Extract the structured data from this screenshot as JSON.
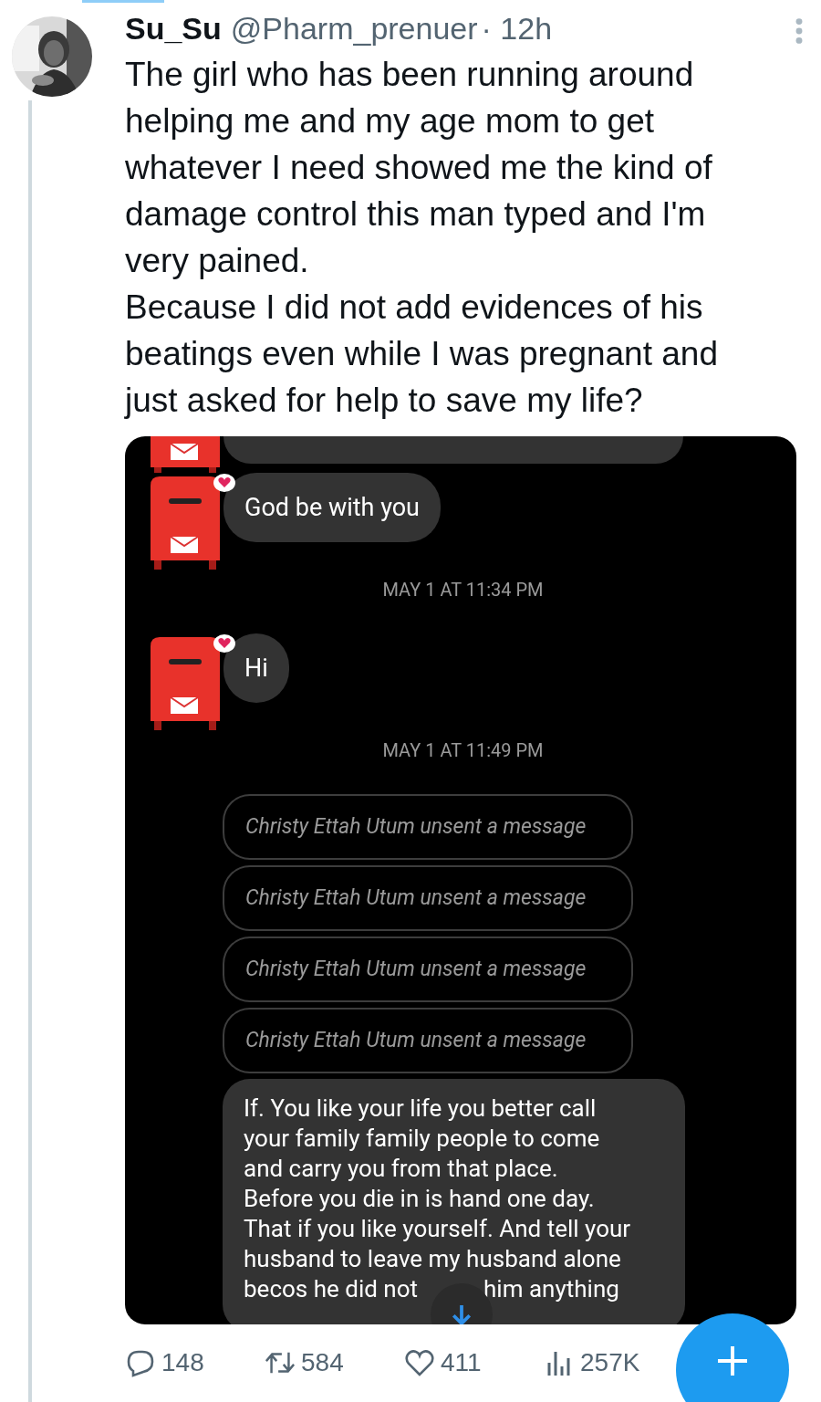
{
  "tweet": {
    "author": {
      "name": "Su_Su",
      "handle": "@Pharm_prenuer",
      "time": "· 12h"
    },
    "paragraphs": [
      "The girl who has been running around helping me and my age mom to get whatever I need showed me the kind of damage control this man typed and I'm very pained.",
      "Because I did not add evidences of his beatings even while I was pregnant and just asked for help to save my life?"
    ],
    "chat": {
      "messages": [
        {
          "kind": "cut_bubble"
        },
        {
          "kind": "text",
          "text": "God be with you",
          "reacted": true
        },
        {
          "kind": "timestamp",
          "text": "MAY 1 AT 11:34 PM"
        },
        {
          "kind": "text",
          "text": "Hi",
          "reacted": true
        },
        {
          "kind": "timestamp",
          "text": "MAY 1 AT 11:49 PM"
        },
        {
          "kind": "unsent",
          "text": "Christy Ettah Utum unsent a message"
        },
        {
          "kind": "unsent",
          "text": "Christy Ettah Utum unsent a message"
        },
        {
          "kind": "unsent",
          "text": "Christy Ettah Utum unsent a message"
        },
        {
          "kind": "unsent",
          "text": "Christy Ettah Utum unsent a message"
        },
        {
          "kind": "long",
          "lines": [
            "If. You like your life you better call",
            "your family family people to come",
            "and carry you from that place.",
            "Before you die in is hand one day.",
            "That if you like yourself. And tell your",
            "husband to leave my husband alone"
          ],
          "last_line": [
            "becos he did not",
            "him anything"
          ]
        }
      ]
    },
    "actions": [
      {
        "kind": "reply",
        "count": "148"
      },
      {
        "kind": "repost",
        "count": "584"
      },
      {
        "kind": "like",
        "count": "411"
      },
      {
        "kind": "views",
        "count": "257K"
      }
    ]
  }
}
